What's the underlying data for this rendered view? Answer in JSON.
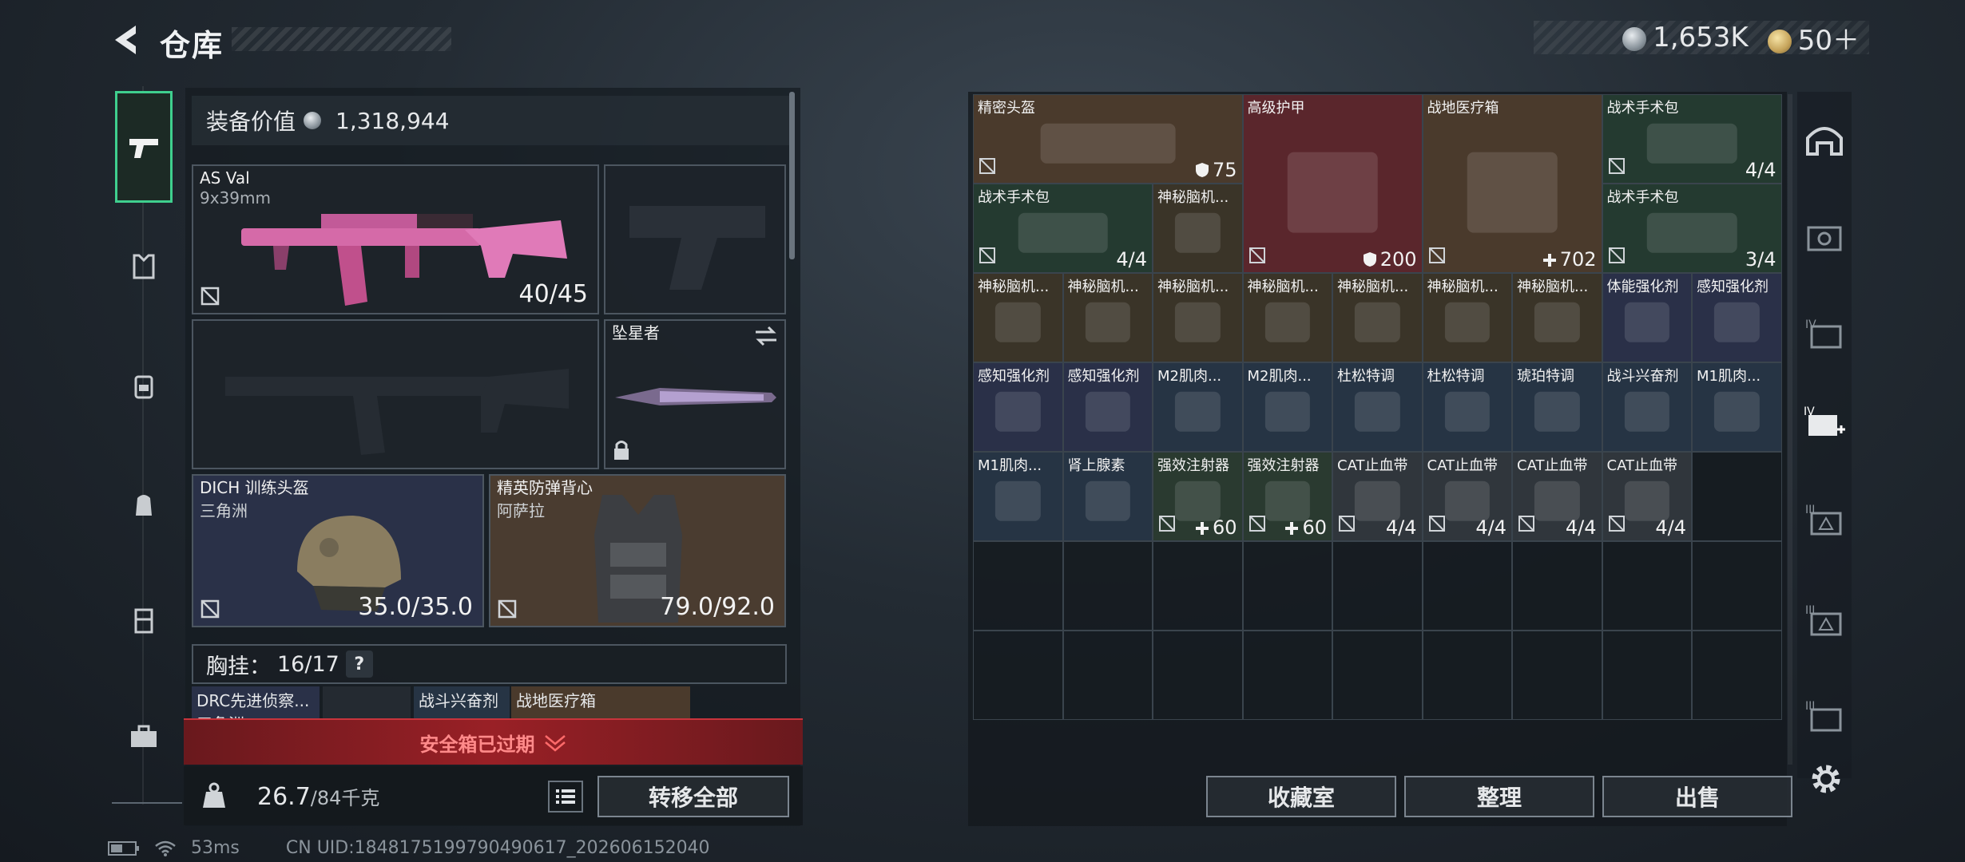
{
  "header": {
    "title": "仓库",
    "currency_silver": "1,653K",
    "currency_gold": "50＋"
  },
  "left_nav": [
    "pistol-icon",
    "armor-icon",
    "chest-rig-icon",
    "backpack-icon",
    "locker-icon",
    "toolbox-icon"
  ],
  "equipment": {
    "value_label": "装备价值",
    "value": "1,318,944",
    "primary": {
      "name": "AS Val",
      "ammo": "9x39mm",
      "value": "40/45"
    },
    "melee": {
      "name": "坠星者"
    },
    "helmet": {
      "name": "DICH 训练头盔",
      "sub": "三角洲",
      "value": "35.0/35.0"
    },
    "vest": {
      "name": "精英防弹背心",
      "sub": "阿萨拉",
      "value": "79.0/92.0"
    },
    "chest_label": "胸挂：",
    "chest_value": "16/17",
    "help": "?",
    "mini_slots": [
      "DRC先进侦察...",
      "三角洲",
      "战斗兴奋剂",
      "战地医疗箱"
    ]
  },
  "safe_box": "安全箱已过期",
  "weight": {
    "current": "26.7",
    "max": "/84千克"
  },
  "transfer_all": "转移全部",
  "status": {
    "ping": "53ms",
    "uid": "CN UID:1848175199790490617_202606152040"
  },
  "stash": {
    "items": [
      {
        "name": "精密头盔",
        "value": "75",
        "badge": "shield",
        "bg": "#4a3a2c"
      },
      {
        "name": "高级护甲",
        "value": "200",
        "badge": "shield",
        "bg": "#5a262c"
      },
      {
        "name": "战地医疗箱",
        "value": "702",
        "badge": "plus",
        "bg": "#4a3a2c"
      },
      {
        "name": "战术手术包",
        "value": "4/4",
        "badge": "",
        "bg": "#243a30"
      },
      {
        "name": "战术手术包",
        "value": "4/4",
        "badge": "",
        "bg": "#243a30"
      },
      {
        "name": "神秘脑机...",
        "value": "",
        "badge": "",
        "bg": "#3a3428"
      },
      {
        "name": "战术手术包",
        "value": "3/4",
        "badge": "",
        "bg": "#243a30"
      },
      {
        "name": "神秘脑机...",
        "value": "",
        "badge": "",
        "bg": "#3a3428"
      },
      {
        "name": "神秘脑机...",
        "value": "",
        "badge": "",
        "bg": "#3a3428"
      },
      {
        "name": "神秘脑机...",
        "value": "",
        "badge": "",
        "bg": "#3a3428"
      },
      {
        "name": "神秘脑机...",
        "value": "",
        "badge": "",
        "bg": "#3a3428"
      },
      {
        "name": "神秘脑机...",
        "value": "",
        "badge": "",
        "bg": "#3a3428"
      },
      {
        "name": "神秘脑机...",
        "value": "",
        "badge": "",
        "bg": "#3a3428"
      },
      {
        "name": "神秘脑机...",
        "value": "",
        "badge": "",
        "bg": "#3a3428"
      },
      {
        "name": "体能强化剂",
        "value": "",
        "badge": "",
        "bg": "#2a3048"
      },
      {
        "name": "感知强化剂",
        "value": "",
        "badge": "",
        "bg": "#2a3048"
      },
      {
        "name": "感知强化剂",
        "value": "",
        "badge": "",
        "bg": "#2a3048"
      },
      {
        "name": "感知强化剂",
        "value": "",
        "badge": "",
        "bg": "#2a3048"
      },
      {
        "name": "M2肌肉...",
        "value": "",
        "badge": "",
        "bg": "#263444"
      },
      {
        "name": "M2肌肉...",
        "value": "",
        "badge": "",
        "bg": "#263444"
      },
      {
        "name": "杜松特调",
        "value": "",
        "badge": "",
        "bg": "#263444"
      },
      {
        "name": "杜松特调",
        "value": "",
        "badge": "",
        "bg": "#263444"
      },
      {
        "name": "琥珀特调",
        "value": "",
        "badge": "",
        "bg": "#263444"
      },
      {
        "name": "战斗兴奋剂",
        "value": "",
        "badge": "",
        "bg": "#263444"
      },
      {
        "name": "M1肌肉...",
        "value": "",
        "badge": "",
        "bg": "#263444"
      },
      {
        "name": "M1肌肉...",
        "value": "",
        "badge": "",
        "bg": "#263444"
      },
      {
        "name": "肾上腺素",
        "value": "",
        "badge": "",
        "bg": "#263444"
      },
      {
        "name": "强效注射器",
        "value": "60",
        "badge": "plus",
        "bg": "#2a3a30"
      },
      {
        "name": "强效注射器",
        "value": "60",
        "badge": "plus",
        "bg": "#2a3a30"
      },
      {
        "name": "CAT止血带",
        "value": "4/4",
        "badge": "",
        "bg": "#30363c"
      },
      {
        "name": "CAT止血带",
        "value": "4/4",
        "badge": "",
        "bg": "#30363c"
      },
      {
        "name": "CAT止血带",
        "value": "4/4",
        "badge": "",
        "bg": "#30363c"
      },
      {
        "name": "CAT止血带",
        "value": "4/4",
        "badge": "",
        "bg": "#30363c"
      }
    ]
  },
  "actions": [
    "收藏室",
    "整理",
    "出售"
  ],
  "right_nav": [
    "bunker-icon",
    "case-1-icon",
    "case-iv-icon",
    "case-iv-plus-icon",
    "case-iii-icon",
    "case-iii-b-icon",
    "case-iii-c-icon"
  ]
}
